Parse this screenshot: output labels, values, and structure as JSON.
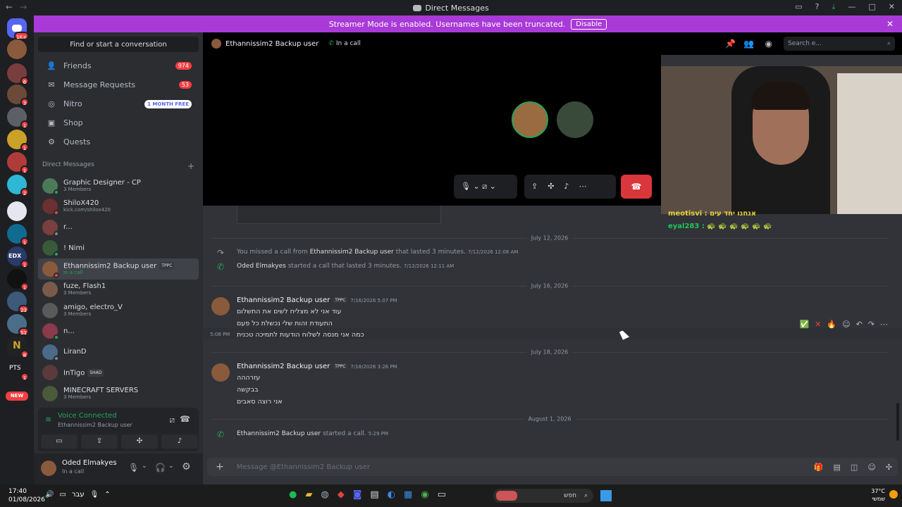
{
  "window": {
    "title": "Direct Messages"
  },
  "server_badges": {
    "home": "1K+",
    "s2": "6",
    "s3": "3",
    "s4": "1",
    "s5": "1",
    "s6": "1",
    "s7": "2",
    "s8": "1",
    "s9": "1",
    "s10": "1",
    "s11": "23",
    "s12": "51",
    "s13": "8",
    "s14": "1",
    "new": "NEW"
  },
  "server_labels": {
    "pts": "PTS",
    "edx": "EDX"
  },
  "banner": {
    "text": "Streamer Mode is enabled. Usernames have been truncated.",
    "disable": "Disable"
  },
  "sidebar": {
    "find": "Find or start a conversation",
    "friends": "Friends",
    "friends_count": "974",
    "requests": "Message Requests",
    "requests_count": "53",
    "nitro": "Nitro",
    "nitro_badge": "1 MONTH FREE",
    "shop": "Shop",
    "quests": "Quests",
    "dm_header": "Direct Messages",
    "dms": [
      {
        "name": "Graphic Designer - CP",
        "sub": "3 Members"
      },
      {
        "name": "ShiloX420",
        "sub": "kick.com/shilox420"
      },
      {
        "name": "r...",
        "sub": ""
      },
      {
        "name": "! Nimi",
        "sub": ""
      },
      {
        "name": "Ethannissim2 Backup user",
        "sub": "In a call",
        "tag": "TPPC"
      },
      {
        "name": "fuze, Flash1",
        "sub": "3 Members"
      },
      {
        "name": "amigo, electro_V",
        "sub": "3 Members"
      },
      {
        "name": "n...",
        "sub": ""
      },
      {
        "name": "LiranD",
        "sub": ""
      },
      {
        "name": "InTigo",
        "sub": "",
        "tag": "SHAD"
      },
      {
        "name": "MINECRAFT SERVERS",
        "sub": "3 Members"
      }
    ]
  },
  "voice": {
    "status": "Voice Connected",
    "channel": "Ethannissim2 Backup user"
  },
  "user": {
    "name": "Oded Elmakyes",
    "status": "In a call"
  },
  "chat": {
    "header_name": "Ethannissim2 Backup user",
    "header_status": "In a call",
    "search_placeholder": "Search e...",
    "overlay_line1": "אנחנו יחד עים : meotisvi",
    "overlay_user": "eyal283 :",
    "overlay_emotes": "🐢 🐢 🐢 🐢 🐢 🐢",
    "date1": "July 12, 2026",
    "missed": {
      "pre": "You missed a call from",
      "name": "Ethannissim2 Backup user",
      "post": "that lasted 3 minutes.",
      "ts": "7/12/2026 12:08 AM"
    },
    "started": {
      "name": "Oded Elmakyes",
      "post": "started a call that lasted 3 minutes.",
      "ts": "7/12/2026 12:11 AM"
    },
    "date2": "July 16, 2026",
    "msg1": {
      "author": "Ethannissim2 Backup user",
      "tag": "TPPC",
      "ts": "7/16/2026 5:07 PM",
      "lines": [
        "עוד אני לא מצליח לשים את התשלום",
        "התעודת זהות שלי נכשלת כל פעם",
        "כמה אני מנסה לשלוח הודעות לתמיכה טכנית"
      ],
      "hover_ts": "5:08 PM"
    },
    "date3": "July 18, 2026",
    "msg2": {
      "author": "Ethannissim2 Backup user",
      "tag": "TPPC",
      "ts": "7/18/2026 3:26 PM",
      "lines": [
        "עזרההה",
        "בבקשה",
        "אני רוצה סאבים"
      ]
    },
    "date4": "August 1, 2026",
    "call_started": {
      "name": "Ethannissim2 Backup user",
      "post": "started a call.",
      "ts": "5:29 PM"
    },
    "composer_placeholder": "Message @Ethannissim2 Backup user"
  },
  "taskbar": {
    "time": "17:40",
    "date": "01/08/2026",
    "lang": "עבר",
    "search": "חפש",
    "weather_temp": "37°C",
    "weather_label": "שמשי"
  }
}
